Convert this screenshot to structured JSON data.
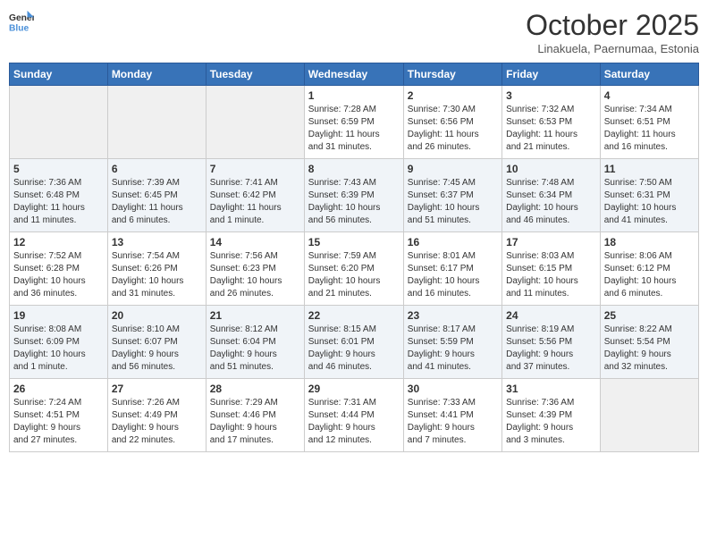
{
  "header": {
    "logo_line1": "General",
    "logo_line2": "Blue",
    "month": "October 2025",
    "location": "Linakuela, Paernumaa, Estonia"
  },
  "days_of_week": [
    "Sunday",
    "Monday",
    "Tuesday",
    "Wednesday",
    "Thursday",
    "Friday",
    "Saturday"
  ],
  "weeks": [
    [
      {
        "day": "",
        "info": "",
        "empty": true
      },
      {
        "day": "",
        "info": "",
        "empty": true
      },
      {
        "day": "",
        "info": "",
        "empty": true
      },
      {
        "day": "1",
        "info": "Sunrise: 7:28 AM\nSunset: 6:59 PM\nDaylight: 11 hours\nand 31 minutes."
      },
      {
        "day": "2",
        "info": "Sunrise: 7:30 AM\nSunset: 6:56 PM\nDaylight: 11 hours\nand 26 minutes."
      },
      {
        "day": "3",
        "info": "Sunrise: 7:32 AM\nSunset: 6:53 PM\nDaylight: 11 hours\nand 21 minutes."
      },
      {
        "day": "4",
        "info": "Sunrise: 7:34 AM\nSunset: 6:51 PM\nDaylight: 11 hours\nand 16 minutes."
      }
    ],
    [
      {
        "day": "5",
        "info": "Sunrise: 7:36 AM\nSunset: 6:48 PM\nDaylight: 11 hours\nand 11 minutes."
      },
      {
        "day": "6",
        "info": "Sunrise: 7:39 AM\nSunset: 6:45 PM\nDaylight: 11 hours\nand 6 minutes."
      },
      {
        "day": "7",
        "info": "Sunrise: 7:41 AM\nSunset: 6:42 PM\nDaylight: 11 hours\nand 1 minute."
      },
      {
        "day": "8",
        "info": "Sunrise: 7:43 AM\nSunset: 6:39 PM\nDaylight: 10 hours\nand 56 minutes."
      },
      {
        "day": "9",
        "info": "Sunrise: 7:45 AM\nSunset: 6:37 PM\nDaylight: 10 hours\nand 51 minutes."
      },
      {
        "day": "10",
        "info": "Sunrise: 7:48 AM\nSunset: 6:34 PM\nDaylight: 10 hours\nand 46 minutes."
      },
      {
        "day": "11",
        "info": "Sunrise: 7:50 AM\nSunset: 6:31 PM\nDaylight: 10 hours\nand 41 minutes."
      }
    ],
    [
      {
        "day": "12",
        "info": "Sunrise: 7:52 AM\nSunset: 6:28 PM\nDaylight: 10 hours\nand 36 minutes."
      },
      {
        "day": "13",
        "info": "Sunrise: 7:54 AM\nSunset: 6:26 PM\nDaylight: 10 hours\nand 31 minutes."
      },
      {
        "day": "14",
        "info": "Sunrise: 7:56 AM\nSunset: 6:23 PM\nDaylight: 10 hours\nand 26 minutes."
      },
      {
        "day": "15",
        "info": "Sunrise: 7:59 AM\nSunset: 6:20 PM\nDaylight: 10 hours\nand 21 minutes."
      },
      {
        "day": "16",
        "info": "Sunrise: 8:01 AM\nSunset: 6:17 PM\nDaylight: 10 hours\nand 16 minutes."
      },
      {
        "day": "17",
        "info": "Sunrise: 8:03 AM\nSunset: 6:15 PM\nDaylight: 10 hours\nand 11 minutes."
      },
      {
        "day": "18",
        "info": "Sunrise: 8:06 AM\nSunset: 6:12 PM\nDaylight: 10 hours\nand 6 minutes."
      }
    ],
    [
      {
        "day": "19",
        "info": "Sunrise: 8:08 AM\nSunset: 6:09 PM\nDaylight: 10 hours\nand 1 minute."
      },
      {
        "day": "20",
        "info": "Sunrise: 8:10 AM\nSunset: 6:07 PM\nDaylight: 9 hours\nand 56 minutes."
      },
      {
        "day": "21",
        "info": "Sunrise: 8:12 AM\nSunset: 6:04 PM\nDaylight: 9 hours\nand 51 minutes."
      },
      {
        "day": "22",
        "info": "Sunrise: 8:15 AM\nSunset: 6:01 PM\nDaylight: 9 hours\nand 46 minutes."
      },
      {
        "day": "23",
        "info": "Sunrise: 8:17 AM\nSunset: 5:59 PM\nDaylight: 9 hours\nand 41 minutes."
      },
      {
        "day": "24",
        "info": "Sunrise: 8:19 AM\nSunset: 5:56 PM\nDaylight: 9 hours\nand 37 minutes."
      },
      {
        "day": "25",
        "info": "Sunrise: 8:22 AM\nSunset: 5:54 PM\nDaylight: 9 hours\nand 32 minutes."
      }
    ],
    [
      {
        "day": "26",
        "info": "Sunrise: 7:24 AM\nSunset: 4:51 PM\nDaylight: 9 hours\nand 27 minutes."
      },
      {
        "day": "27",
        "info": "Sunrise: 7:26 AM\nSunset: 4:49 PM\nDaylight: 9 hours\nand 22 minutes."
      },
      {
        "day": "28",
        "info": "Sunrise: 7:29 AM\nSunset: 4:46 PM\nDaylight: 9 hours\nand 17 minutes."
      },
      {
        "day": "29",
        "info": "Sunrise: 7:31 AM\nSunset: 4:44 PM\nDaylight: 9 hours\nand 12 minutes."
      },
      {
        "day": "30",
        "info": "Sunrise: 7:33 AM\nSunset: 4:41 PM\nDaylight: 9 hours\nand 7 minutes."
      },
      {
        "day": "31",
        "info": "Sunrise: 7:36 AM\nSunset: 4:39 PM\nDaylight: 9 hours\nand 3 minutes."
      },
      {
        "day": "",
        "info": "",
        "empty": true
      }
    ]
  ]
}
